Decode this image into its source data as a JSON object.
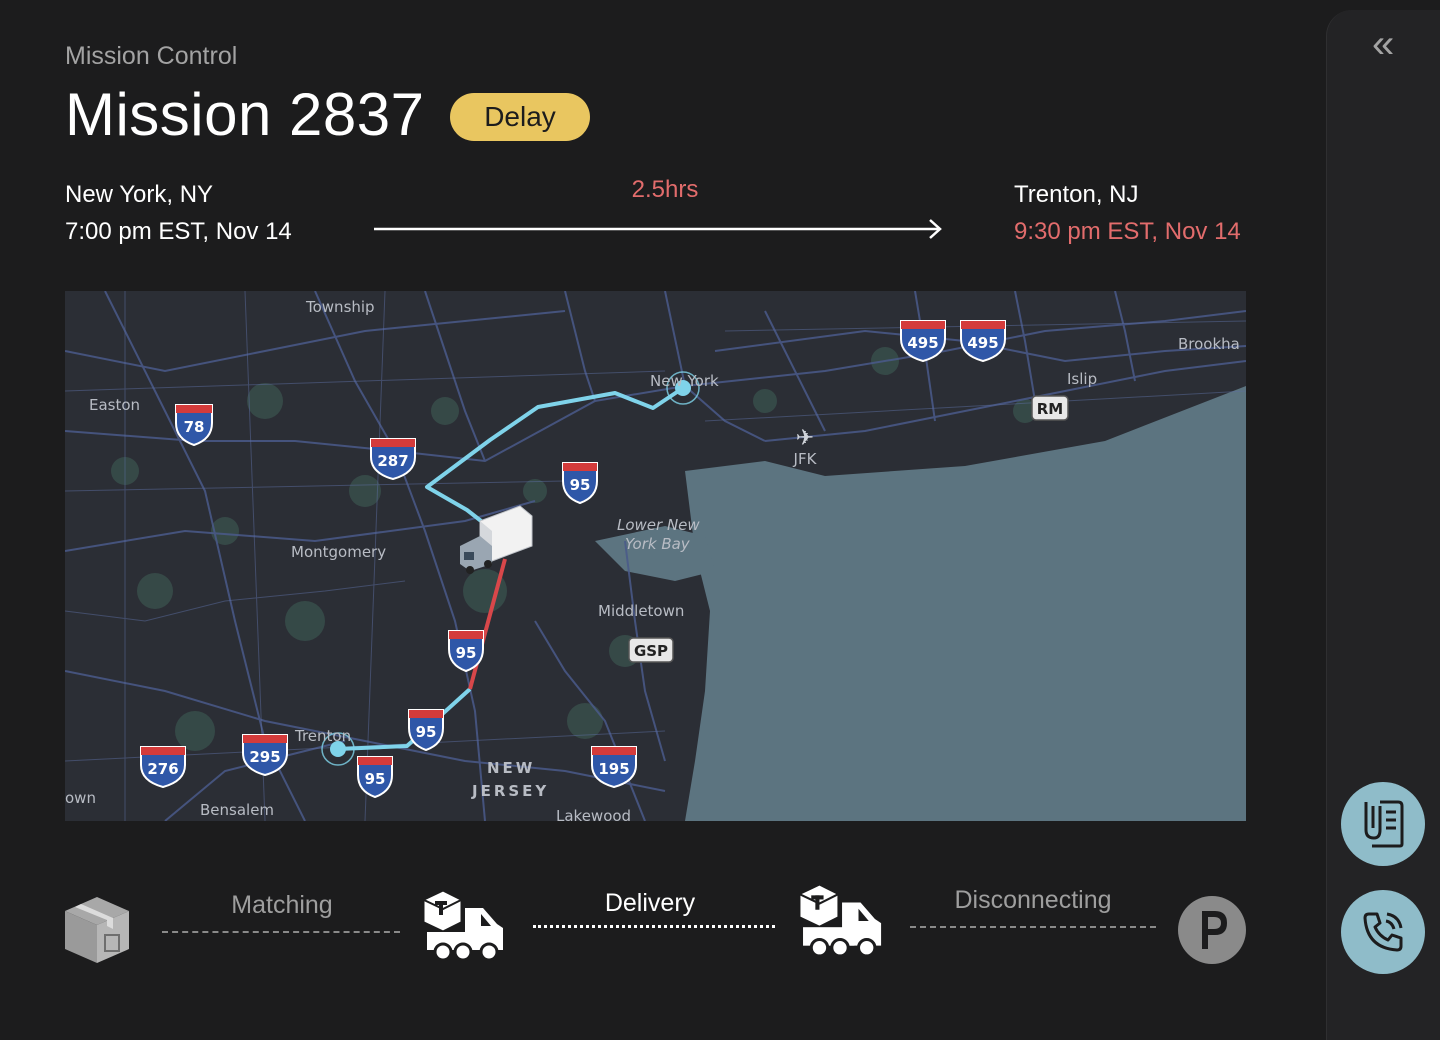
{
  "header": {
    "breadcrumb": "Mission Control",
    "title": "Mission 2837",
    "status_badge": "Delay"
  },
  "route": {
    "origin_city": "New York, NY",
    "origin_time": "7:00 pm EST, Nov 14",
    "duration": "2.5hrs",
    "destination_city": "Trenton, NJ",
    "destination_time": "9:30 pm EST, Nov 14"
  },
  "map": {
    "labels": {
      "new_york": "New York",
      "trenton": "Trenton",
      "easton": "Easton",
      "montgomery": "Montgomery",
      "middletown": "Middletown",
      "new_jersey_1": "NEW",
      "new_jersey_2": "JERSEY",
      "lakewood": "Lakewood",
      "bensalem": "Bensalem",
      "islip": "Islip",
      "brookhaven": "Brookha",
      "jfk": "JFK",
      "lower_ny_bay_1": "Lower New",
      "lower_ny_bay_2": "York Bay",
      "township": "Township",
      "town_left": "own"
    },
    "shields": {
      "i78": "78",
      "i287": "287",
      "i95a": "95",
      "i95b": "95",
      "i95c": "95",
      "i95d": "95",
      "i295": "295",
      "i276": "276",
      "i195": "195",
      "i495a": "495",
      "i495b": "495",
      "rm": "RM",
      "gsp": "GSP"
    },
    "colors": {
      "route_traveled": "#7fd3ea",
      "route_delay": "#d8474a",
      "water": "#5c7480"
    }
  },
  "progress": {
    "step1_label": "Matching",
    "step2_label": "Delivery",
    "step3_label": "Disconnecting",
    "icons": [
      "package-icon",
      "delivery-truck-icon",
      "delivery-truck-icon",
      "parking-icon"
    ]
  },
  "sidebar": {
    "collapse_glyph": "«",
    "buttons": [
      "document-icon",
      "phone-icon"
    ]
  }
}
